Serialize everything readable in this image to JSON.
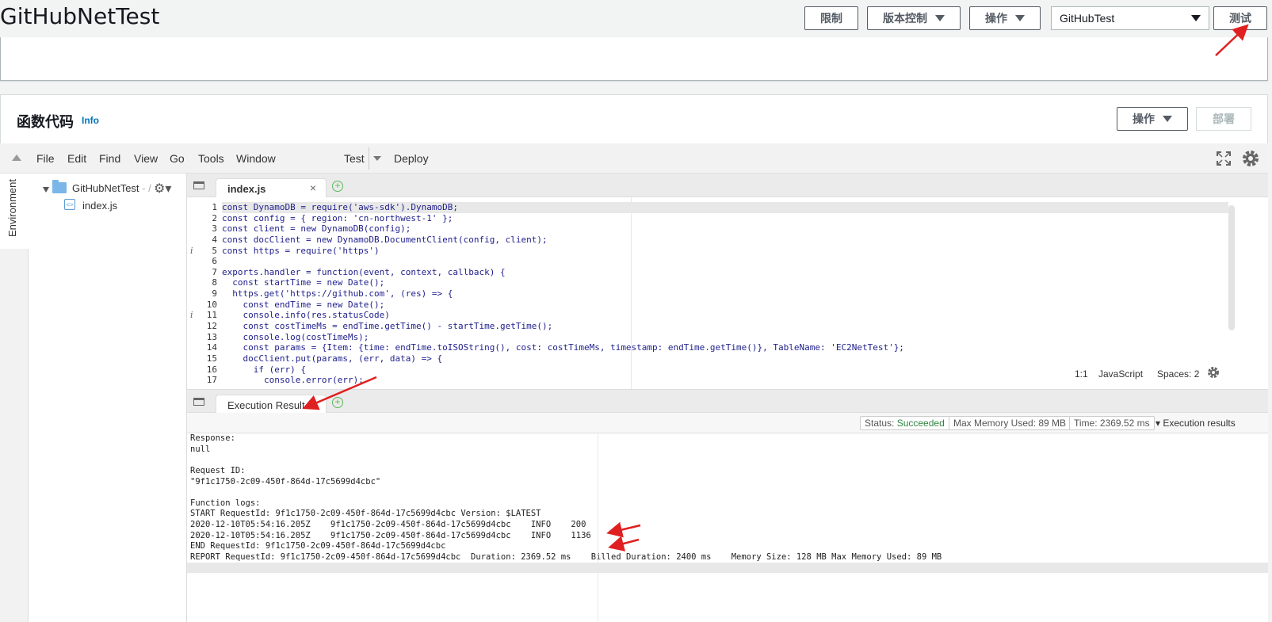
{
  "header": {
    "function_name": "GitHubNetTest",
    "throttle_label": "限制",
    "version_label": "版本控制",
    "actions_label": "操作",
    "test_event": "GitHubTest",
    "test_label": "测试"
  },
  "panel": {
    "title": "函数代码",
    "info": "Info",
    "actions_label": "操作",
    "deploy_label": "部署"
  },
  "ide": {
    "menu": [
      "File",
      "Edit",
      "Find",
      "View",
      "Go",
      "Tools",
      "Window"
    ],
    "test": "Test",
    "deploy": "Deploy",
    "env_label": "Environment",
    "tree_root": "GitHubNetTest",
    "tree_root_suffix": "- /",
    "tree_file": "index.js",
    "tab_label": "index.js",
    "tab_close": "×",
    "result_tab": "Execution Result",
    "status_cursor": "1:1",
    "status_lang": "JavaScript",
    "status_spaces": "Spaces: 2"
  },
  "code": {
    "line_numbers": [
      "1",
      "2",
      "3",
      "4",
      "5",
      "6",
      "7",
      "8",
      "9",
      "10",
      "11",
      "12",
      "13",
      "14",
      "15",
      "16",
      "17"
    ],
    "info_markers": [
      "5",
      "11"
    ],
    "lines": [
      "const DynamoDB = require('aws-sdk').DynamoDB;",
      "const config = { region: 'cn-northwest-1' };",
      "const client = new DynamoDB(config);",
      "const docClient = new DynamoDB.DocumentClient(config, client);",
      "const https = require('https')",
      "",
      "exports.handler = function(event, context, callback) {",
      "  const startTime = new Date();",
      "  https.get('https://github.com', (res) => {",
      "    const endTime = new Date();",
      "    console.info(res.statusCode)",
      "    const costTimeMs = endTime.getTime() - startTime.getTime();",
      "    console.log(costTimeMs);",
      "    const params = {Item: {time: endTime.toISOString(), cost: costTimeMs, timestamp: endTime.getTime()}, TableName: 'EC2NetTest'};",
      "    docClient.put(params, (err, data) => {",
      "      if (err) {",
      "        console.error(err);"
    ]
  },
  "result": {
    "status_label": "Status:",
    "status_value": "Succeeded",
    "memory": "Max Memory Used: 89 MB",
    "time": "Time: 2369.52 ms",
    "exec_results": "Execution results",
    "output_lines": [
      "Response:",
      "null",
      "",
      "Request ID:",
      "\"9f1c1750-2c09-450f-864d-17c5699d4cbc\"",
      "",
      "Function logs:",
      "START RequestId: 9f1c1750-2c09-450f-864d-17c5699d4cbc Version: $LATEST",
      "2020-12-10T05:54:16.205Z    9f1c1750-2c09-450f-864d-17c5699d4cbc    INFO    200",
      "2020-12-10T05:54:16.205Z    9f1c1750-2c09-450f-864d-17c5699d4cbc    INFO    1136",
      "END RequestId: 9f1c1750-2c09-450f-864d-17c5699d4cbc",
      "REPORT RequestId: 9f1c1750-2c09-450f-864d-17c5699d4cbc  Duration: 2369.52 ms    Billed Duration: 2400 ms    Memory Size: 128 MB Max Memory Used: 89 MB"
    ]
  },
  "colors": {
    "annotation_arrow": "#e02020",
    "success": "#2e8540",
    "link": "#0073bb"
  }
}
